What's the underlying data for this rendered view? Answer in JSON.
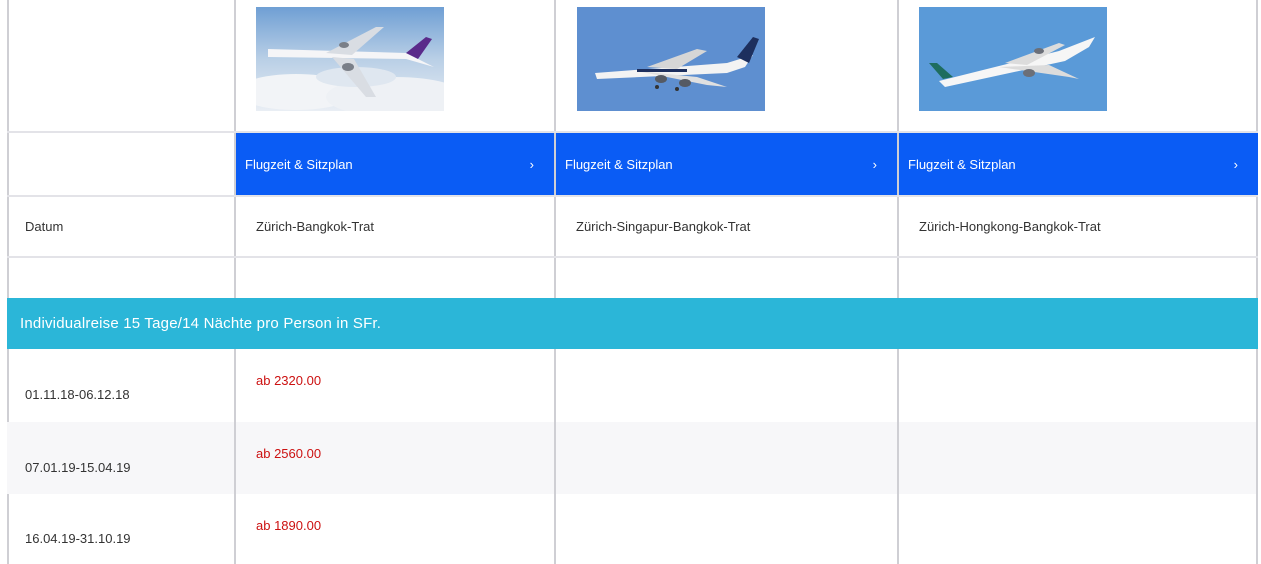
{
  "columns": [
    {
      "route": "Zürich-Bangkok-Trat",
      "button_label": "Flugzeit & Sitzplan",
      "chevron": "›"
    },
    {
      "route": "Zürich-Singapur-Bangkok-Trat",
      "button_label": "Flugzeit & Sitzplan",
      "chevron": "›"
    },
    {
      "route": "Zürich-Hongkong-Bangkok-Trat",
      "button_label": "Flugzeit & Sitzplan",
      "chevron": "›"
    }
  ],
  "route_row_label": "Datum",
  "section_title": "Individualreise 15 Tage/14 Nächte pro Person in SFr.",
  "price_rows": [
    {
      "date": "01.11.18-06.12.18",
      "prices": [
        "ab 2320.00",
        "",
        ""
      ]
    },
    {
      "date": "07.01.19-15.04.19",
      "prices": [
        "ab 2560.00",
        "",
        ""
      ]
    },
    {
      "date": "16.04.19-31.10.19",
      "prices": [
        "ab 1890.00",
        "",
        ""
      ]
    }
  ],
  "colors": {
    "button_blue": "#0a5cf5",
    "header_teal": "#2bb6d8",
    "price_red": "#cc1111"
  },
  "images": [
    "airplane-thai-image",
    "airplane-singapore-a380-image",
    "airplane-cathay-image"
  ]
}
